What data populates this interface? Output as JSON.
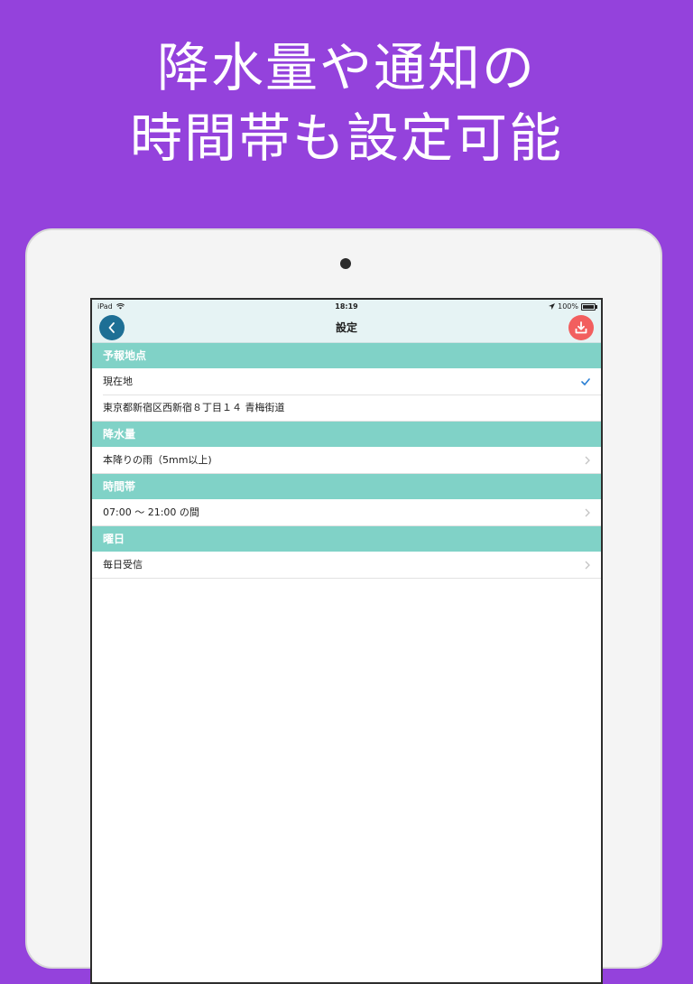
{
  "promo": {
    "line1": "降水量や通知の",
    "line2": "時間帯も設定可能"
  },
  "status_bar": {
    "device": "iPad",
    "time": "18:19",
    "battery": "100%"
  },
  "nav": {
    "title": "設定"
  },
  "sections": {
    "forecast_location": {
      "header": "予報地点",
      "rows": [
        "現在地",
        "東京都新宿区西新宿８丁目１４ 青梅街道"
      ]
    },
    "precipitation": {
      "header": "降水量",
      "rows": [
        "本降りの雨（5mm以上)"
      ]
    },
    "time_range": {
      "header": "時間帯",
      "rows": [
        "07:00 〜 21:00 の間"
      ]
    },
    "weekday": {
      "header": "曜日",
      "rows": [
        "毎日受信"
      ]
    }
  },
  "icons": {
    "back": "chevron-left-icon",
    "action": "download-tray-icon",
    "selected": "checkmark-icon",
    "disclosure": "chevron-right-icon"
  },
  "colors": {
    "background": "#9442dc",
    "nav_bar": "#e6f3f4",
    "section_header": "#80d2c7",
    "back_button": "#1e6f95",
    "action_button": "#f25f5f",
    "checkmark": "#2a7fd4"
  }
}
